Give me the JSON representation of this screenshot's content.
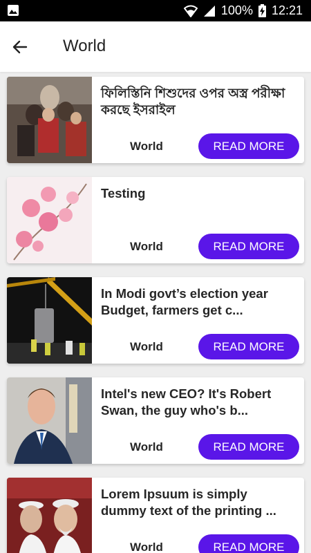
{
  "status_bar": {
    "battery": "100%",
    "time": "12:21"
  },
  "header": {
    "title": "World"
  },
  "accent_color": "#5a16e8",
  "articles": [
    {
      "title": "ফিলিস্তিনি শিশুদের ওপর অস্ত্র পরীক্ষা করছে ইসরাইল",
      "category": "World",
      "button": "READ MORE",
      "image": "refugee-family-photo"
    },
    {
      "title": "Testing",
      "category": "World",
      "button": "READ MORE",
      "image": "pink-flowers-photo"
    },
    {
      "title": "In Modi govt’s election year Budget, farmers get c...",
      "category": "World",
      "button": "READ MORE",
      "image": "night-construction-crane-photo"
    },
    {
      "title": "Intel's new CEO? It's Robert Swan, the guy who's b...",
      "category": "World",
      "button": "READ MORE",
      "image": "man-in-suit-photo"
    },
    {
      "title": "Lorem Ipsuum is simply dummy text of the printing ...",
      "category": "World",
      "button": "READ MORE",
      "image": "two-men-caps-photo"
    }
  ]
}
